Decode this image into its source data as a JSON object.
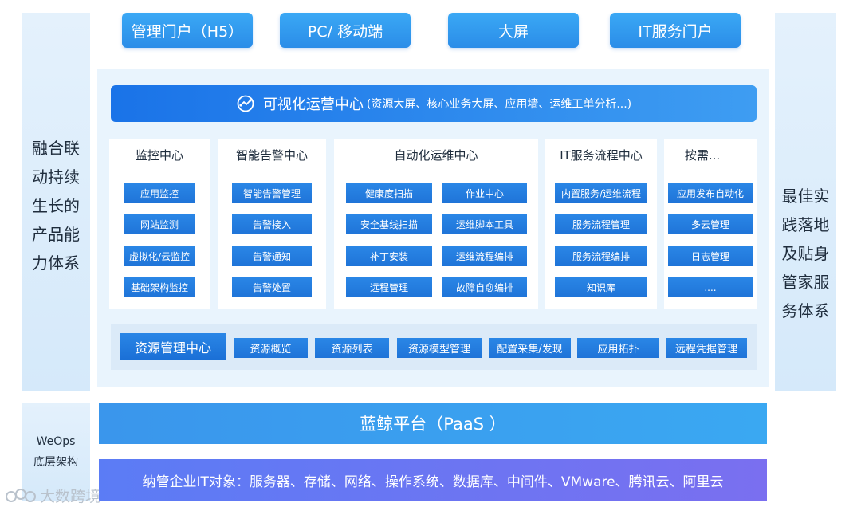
{
  "top_buttons": [
    "管理门户（H5）",
    "PC/ 移动端",
    "大屏",
    "IT服务门户"
  ],
  "left_side_lines": [
    "融合联",
    "动持续",
    "生长的",
    "产品能",
    "力体系"
  ],
  "right_side_lines": [
    "最佳实",
    "践落地",
    "及贴身",
    "管家服",
    "务体系"
  ],
  "viz": {
    "title": "可视化运营中心",
    "subtitle": "(资源大屏、核心业务大屏、应用墙、运维工单分析...)",
    "icon": "chart-analysis-icon"
  },
  "cards": [
    {
      "title": "监控中心",
      "chips": [
        "应用监控",
        "网站监测",
        "虚拟化/云监控",
        "基础架构监控"
      ]
    },
    {
      "title": "智能告警中心",
      "chips": [
        "智能告警管理",
        "告警接入",
        "告警通知",
        "告警处置"
      ]
    },
    {
      "title": "自动化运维中心",
      "chips": [
        "健康度扫描",
        "作业中心",
        "安全基线扫描",
        "运维脚本工具",
        "补丁安装",
        "运维流程编排",
        "远程管理",
        "故障自愈编排"
      ]
    },
    {
      "title": "IT服务流程中心",
      "chips": [
        "内置服务/运维流程",
        "服务流程管理",
        "服务流程编排",
        "知识库"
      ]
    },
    {
      "title": "按需...",
      "chips": [
        "应用发布自动化",
        "多云管理",
        "日志管理",
        "...."
      ]
    }
  ],
  "resource": {
    "main": "资源管理中心",
    "chips": [
      "资源概览",
      "资源列表",
      "资源模型管理",
      "配置采集/发现",
      "应用拓扑",
      "远程凭据管理"
    ]
  },
  "paas": "蓝鲸平台（PaaS ）",
  "infra": "纳管企业IT对象：服务器、存储、网络、操作系统、数据库、中间件、VMware、腾讯云、阿里云",
  "weops": [
    "WeOps",
    "底层架构"
  ],
  "watermark": "大数跨境",
  "colors": {
    "primary": "#1f74d8",
    "light_bg": "#e9f4fd",
    "infra": "#6a76f2"
  }
}
